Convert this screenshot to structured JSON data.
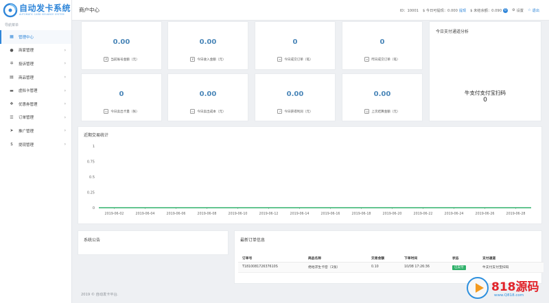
{
  "brand": {
    "title": "自动发卡系统",
    "subtitle": "AUTOMATIC CARD ISSUANCE SYSTEM"
  },
  "sidebar": {
    "heading": "导航菜单",
    "items": [
      {
        "label": "管理中心",
        "icon": "grid-icon",
        "glyph": "▦",
        "active": true,
        "arrow": ""
      },
      {
        "label": "商家管理",
        "icon": "user-icon",
        "glyph": "●",
        "active": false,
        "arrow": "›"
      },
      {
        "label": "投诉管理",
        "icon": "gear-icon",
        "glyph": "✲",
        "active": false,
        "arrow": "›"
      },
      {
        "label": "商品管理",
        "icon": "box-icon",
        "glyph": "▤",
        "active": false,
        "arrow": "›"
      },
      {
        "label": "虚拟卡管理",
        "icon": "card-icon",
        "glyph": "▬",
        "active": false,
        "arrow": "›"
      },
      {
        "label": "优惠券管理",
        "icon": "gift-icon",
        "glyph": "❖",
        "active": false,
        "arrow": "›"
      },
      {
        "label": "订单管理",
        "icon": "list-icon",
        "glyph": "☰",
        "active": false,
        "arrow": "›"
      },
      {
        "label": "推广管理",
        "icon": "send-icon",
        "glyph": "➤",
        "active": false,
        "arrow": "›"
      },
      {
        "label": "提现管理",
        "icon": "dollar-icon",
        "glyph": "$",
        "active": false,
        "arrow": "›"
      }
    ]
  },
  "header": {
    "title": "商户中心",
    "user_id": "ID：10001",
    "withdrawable": "$ 今日可提现：0.000",
    "withdraw_link": "提现",
    "unsettled": "$ 未结余额：0.090",
    "unsettled_badge": "0",
    "settings": "设置",
    "logout": "退出"
  },
  "stats": [
    {
      "value": "0.00",
      "label": "当前账号金额（元）",
      "icon": "wallet-icon",
      "glyph": "¥"
    },
    {
      "value": "0.00",
      "label": "今日收入金额（元）",
      "icon": "coin-icon",
      "glyph": "¥"
    },
    {
      "value": "0",
      "label": "今日成交订单（笔）",
      "icon": "order-icon",
      "glyph": "≡"
    },
    {
      "value": "0",
      "label": "昨日成交订单（笔）",
      "icon": "order-history-icon",
      "glyph": "≡"
    },
    {
      "value": "0",
      "label": "今日卖出卡量（张）",
      "icon": "card-stack-icon",
      "glyph": "▭"
    },
    {
      "value": "0.00",
      "label": "今日卖出成本（元）",
      "icon": "cost-icon",
      "glyph": "▭"
    },
    {
      "value": "0.00",
      "label": "今日获得利润（元）",
      "icon": "profit-icon",
      "glyph": "↗"
    },
    {
      "value": "0.00",
      "label": "上次结算金额（元）",
      "icon": "settle-icon",
      "glyph": "◎"
    }
  ],
  "payment_panel": {
    "title": "今日支付通道分析",
    "channel": "牛支付支付宝扫码",
    "value": "0"
  },
  "trend": {
    "title": "近期交易统计"
  },
  "chart_data": {
    "type": "line",
    "title": "近期交易统计",
    "x": [
      "2019-06-01",
      "2019-06-02",
      "2019-06-03",
      "2019-06-04",
      "2019-06-05",
      "2019-06-06",
      "2019-06-07",
      "2019-06-08",
      "2019-06-09",
      "2019-06-10",
      "2019-06-11",
      "2019-06-12",
      "2019-06-13",
      "2019-06-14",
      "2019-06-15",
      "2019-06-16",
      "2019-06-17",
      "2019-06-18",
      "2019-06-19",
      "2019-06-20",
      "2019-06-21",
      "2019-06-22",
      "2019-06-23",
      "2019-06-24",
      "2019-06-25",
      "2019-06-26",
      "2019-06-27",
      "2019-06-28",
      "2019-06-29"
    ],
    "x_ticks": [
      "2019-06-02",
      "2019-06-04",
      "2019-06-06",
      "2019-06-08",
      "2019-06-10",
      "2019-06-12",
      "2019-06-14",
      "2019-06-16",
      "2019-06-18",
      "2019-06-20",
      "2019-06-22",
      "2019-06-24",
      "2019-06-26",
      "2019-06-28"
    ],
    "series": [
      {
        "values": [
          0,
          0,
          0,
          0,
          0,
          0,
          0,
          0,
          0,
          0,
          0,
          0,
          0,
          0,
          0,
          0,
          0,
          0,
          0,
          0,
          0,
          0,
          0,
          0,
          0,
          0,
          0,
          0,
          0
        ],
        "color": "#2fb16a"
      }
    ],
    "y_ticks": [
      "1",
      "0.75",
      "0.5",
      "0.25",
      "0"
    ],
    "ylim": [
      0,
      1
    ],
    "grid": false,
    "xlabel": "",
    "ylabel": ""
  },
  "notice": {
    "title": "系统公告"
  },
  "orders": {
    "title": "最新订单信息",
    "columns": [
      "订单号",
      "商品名称",
      "交易金额",
      "下单时间",
      "状态",
      "支付通道"
    ],
    "rows": [
      {
        "order_no": "T181008172637610S",
        "product": "绝地求生卡密（1张）",
        "amount": "0.10",
        "time": "10/08 17:26:36",
        "status": "已支付",
        "channel": "牛支付支付宝扫码"
      }
    ]
  },
  "footer": {
    "text": "2019 © 自动发卡平台."
  },
  "watermark": {
    "text": "818源码",
    "url": "www.Q818.com"
  }
}
